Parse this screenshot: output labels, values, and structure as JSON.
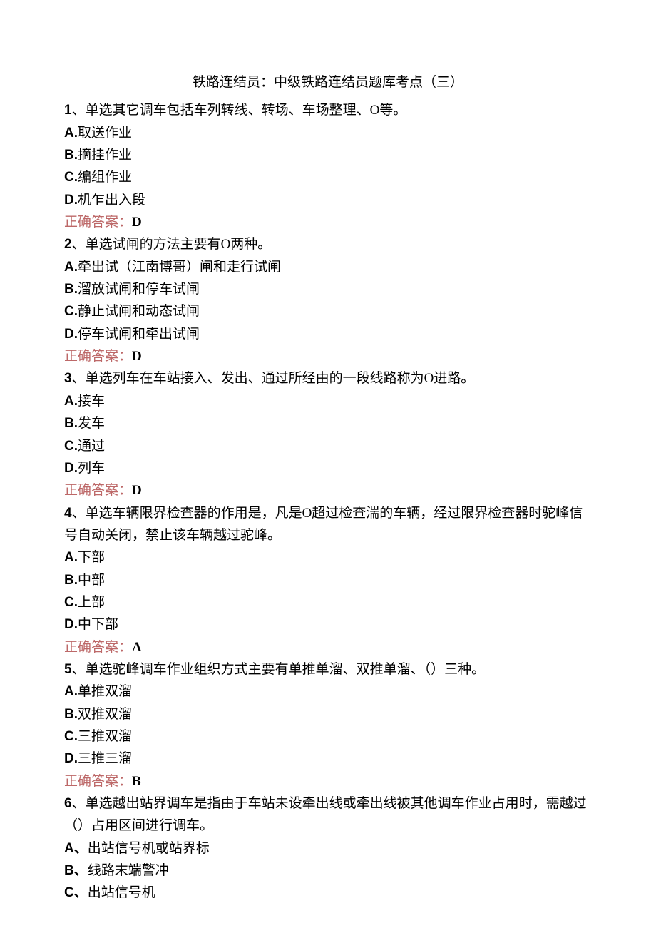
{
  "title": "铁路连结员：中级铁路连结员题库考点（三）",
  "questions": [
    {
      "num": "1",
      "stem": "、单选其它调车包括车列转线、转场、车场整理、O等。",
      "options": [
        {
          "letter": "A.",
          "text": "取送作业"
        },
        {
          "letter": "B.",
          "text": "摘挂作业"
        },
        {
          "letter": "C.",
          "text": "编组作业"
        },
        {
          "letter": "D.",
          "text": "机乍出入段"
        }
      ],
      "answer_label": "正确答案：",
      "answer_value": "D"
    },
    {
      "num": "2",
      "stem": "、单选试闸的方法主要有O两种。",
      "options": [
        {
          "letter": "A.",
          "text": "牵出试（江南博哥）闸和走行试闸"
        },
        {
          "letter": "B.",
          "text": "溜放试闸和停车试闸"
        },
        {
          "letter": "C.",
          "text": "静止试闸和动态试闸"
        },
        {
          "letter": "D.",
          "text": "停车试闸和牵出试闸"
        }
      ],
      "answer_label": "正确答案：",
      "answer_value": "D"
    },
    {
      "num": "3",
      "stem": "、单选列车在车站接入、发出、通过所经由的一段线路称为O进路。",
      "options": [
        {
          "letter": "A.",
          "text": "接车"
        },
        {
          "letter": "B.",
          "text": "发车"
        },
        {
          "letter": "C.",
          "text": "通过"
        },
        {
          "letter": "D.",
          "text": "列车"
        }
      ],
      "answer_label": "正确答案：",
      "answer_value": "D"
    },
    {
      "num": "4",
      "stem": "、单选车辆限界检查器的作用是，凡是O超过检查湍的车辆，经过限界检查器时驼峰信号自动关闭，禁止该车辆越过驼峰。",
      "options": [
        {
          "letter": "A.",
          "text": "下部"
        },
        {
          "letter": "B.",
          "text": "中部"
        },
        {
          "letter": "C.",
          "text": "上部"
        },
        {
          "letter": "D.",
          "text": "中下部"
        }
      ],
      "answer_label": "正确答案：",
      "answer_value": "A"
    },
    {
      "num": "5",
      "stem": "、单选驼峰调车作业组织方式主要有单推单溜、双推单溜、（）三种。",
      "options": [
        {
          "letter": "A.",
          "text": "单推双溜"
        },
        {
          "letter": "B.",
          "text": "双推双溜"
        },
        {
          "letter": "C.",
          "text": "三推双溜"
        },
        {
          "letter": "D.",
          "text": "三推三溜"
        }
      ],
      "answer_label": "正确答案：",
      "answer_value": "B"
    },
    {
      "num": "6",
      "stem": "、单选越出站界调车是指由于车站未设牵出线或牵出线被其他调车作业占用时，需越过（）占用区间进行调车。",
      "options": [
        {
          "letter": "A、",
          "text": "出站信号机或站界标"
        },
        {
          "letter": "B、",
          "text": "线路末端警冲"
        },
        {
          "letter": "C、",
          "text": "出站信号机"
        }
      ],
      "answer_label": "",
      "answer_value": ""
    }
  ]
}
